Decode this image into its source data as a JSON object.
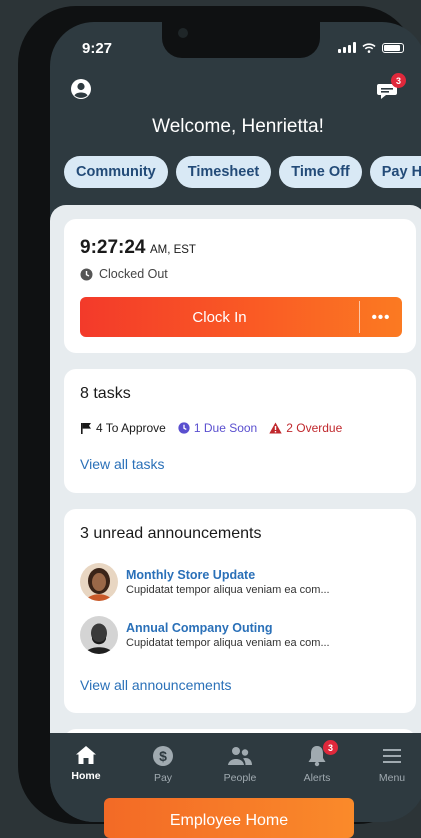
{
  "status_bar": {
    "time": "9:27"
  },
  "header": {
    "greeting": "Welcome, Henrietta!",
    "messages_badge": "3",
    "icons": {
      "profile": "user-circle-icon",
      "messages": "chat-bubble-icon"
    }
  },
  "quick_links": [
    "Community",
    "Timesheet",
    "Time Off",
    "Pay Hi"
  ],
  "clock_card": {
    "time": "9:27:24",
    "meridiem_zone": "AM, EST",
    "status": "Clocked Out",
    "button_label": "Clock In",
    "more_label": "•••"
  },
  "tasks_card": {
    "title": "8 tasks",
    "to_approve": "4 To Approve",
    "due_soon": "1 Due Soon",
    "overdue": "2 Overdue",
    "view_all": "View all tasks",
    "colors": {
      "due_soon": "#5a4fcf",
      "overdue": "#c0282d"
    }
  },
  "announcements_card": {
    "title": "3 unread announcements",
    "items": [
      {
        "title": "Monthly Store Update",
        "snippet": "Cupidatat tempor aliqua veniam ea com..."
      },
      {
        "title": "Annual Company Outing",
        "snippet": "Cupidatat tempor aliqua veniam ea com..."
      }
    ],
    "view_all": "View all announcements"
  },
  "tab_bar": {
    "tabs": [
      {
        "label": "Home",
        "icon": "home-icon",
        "active": true
      },
      {
        "label": "Pay",
        "icon": "dollar-icon",
        "active": false
      },
      {
        "label": "People",
        "icon": "people-icon",
        "active": false
      },
      {
        "label": "Alerts",
        "icon": "bell-icon",
        "active": false,
        "badge": "3"
      },
      {
        "label": "Menu",
        "icon": "menu-icon",
        "active": false
      }
    ]
  },
  "toast": {
    "label": "Employee Home"
  },
  "colors": {
    "accent": "#fa5b24",
    "link": "#2a70b8",
    "badge": "#e0283b",
    "chip_bg": "#d9e9f5"
  }
}
